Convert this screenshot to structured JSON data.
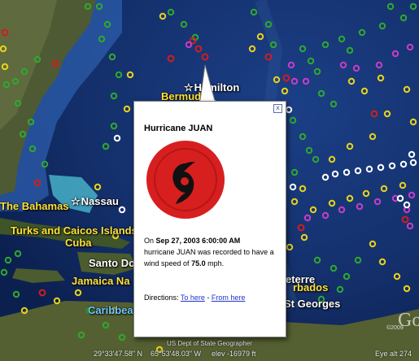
{
  "places": {
    "hamilton": "Hamilton",
    "bermuda": "Bermuda",
    "nassau": "Nassau",
    "bahamas": "The Bahamas",
    "turks": "Turks and Caicos Islands",
    "cuba": "Cuba",
    "santo_domingo": "Santo Do",
    "jamaica": "Jamaica Na",
    "caribbean": "Caribbea",
    "eterre": "eterre",
    "barbados": "rbados",
    "st_georges": "St Georges"
  },
  "balloon": {
    "title": "Hurricane JUAN",
    "on_label": "On",
    "date": "Sep 27, 2003 6:00:00 AM",
    "text_prefix": "hurricane JUAN was recorded to have a wind speed of",
    "wind_speed": "75.0",
    "unit": "mph.",
    "directions_label": "Directions:",
    "to_here": "To here",
    "separator": " - ",
    "from_here": "From here",
    "close_glyph": "x"
  },
  "status": {
    "credit": "US Dept of State Geographer",
    "lat": "29°33'47.58\" N",
    "lon": "65°53'48.03\" W",
    "elev": "elev -16979 ft",
    "eye_alt": "Eye alt 274"
  },
  "brand": {
    "logo": "Go",
    "year": "©2009"
  },
  "colors": {
    "red": "#d21d1d",
    "yellow": "#e6d21a",
    "green": "#2fa82f",
    "magenta": "#c83cc8",
    "white": "#ffffff",
    "icon_red": "#d71f1f"
  }
}
